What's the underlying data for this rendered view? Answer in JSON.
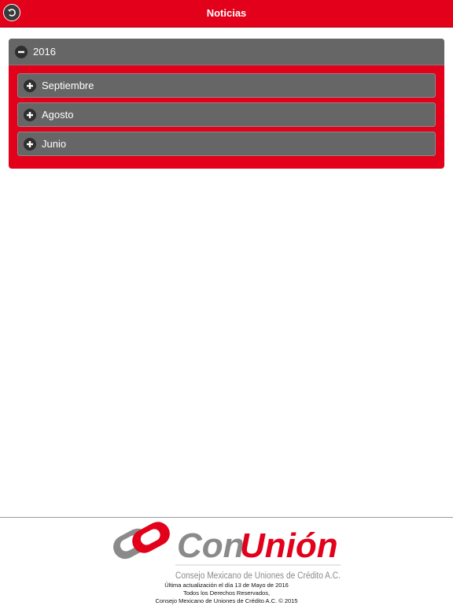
{
  "header": {
    "title": "Noticias",
    "back_icon": "back-arrow-icon"
  },
  "accordion": {
    "year": "2016",
    "expanded": true,
    "months": [
      {
        "label": "Septiembre"
      },
      {
        "label": "Agosto"
      },
      {
        "label": "Junio"
      }
    ]
  },
  "footer": {
    "logo": {
      "con": "Con",
      "union": "Unión",
      "subtitle": "Consejo Mexicano de Uniones de Crédito A.C."
    },
    "lines": [
      "Última actualización el día 13 de Mayo de 2016",
      "Todos los Derechos Reservados,",
      "Consejo Mexicano de Uniones de Crédito A.C. © 2015"
    ]
  },
  "colors": {
    "brand_red": "#e2001a",
    "panel_grey": "#666666",
    "logo_grey": "#8a8a8a"
  }
}
